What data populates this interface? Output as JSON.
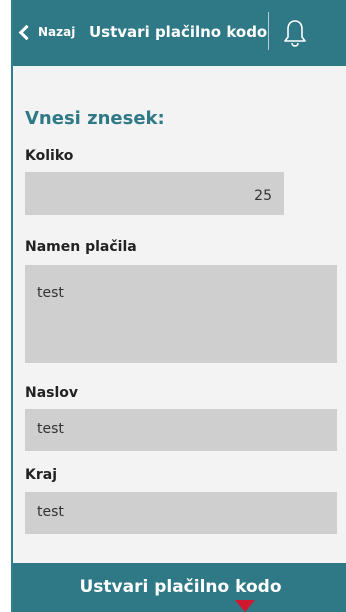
{
  "header": {
    "back_label": "Nazaj",
    "title": "Ustvari plačilno kodo",
    "notification_icon": "bell-icon"
  },
  "form": {
    "section_title": "Vnesi znesek:",
    "amount": {
      "label": "Koliko",
      "value": "25"
    },
    "purpose": {
      "label": "Namen plačila",
      "value": "test"
    },
    "address": {
      "label": "Naslov",
      "value": "test"
    },
    "city": {
      "label": "Kraj",
      "value": "test"
    }
  },
  "footer": {
    "button_label": "Ustvari plačilno kodo"
  },
  "colors": {
    "accent": "#2f7886",
    "field_bg": "#cfcfcf",
    "background": "#f3f3f3",
    "pointer": "#d0192e"
  }
}
